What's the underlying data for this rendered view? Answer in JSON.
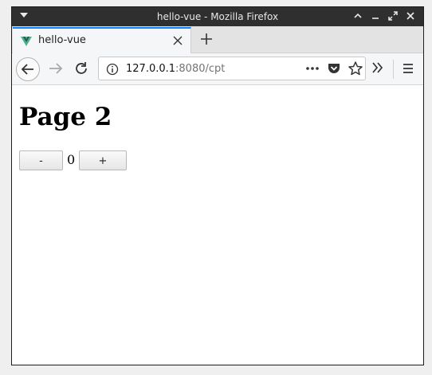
{
  "window": {
    "title": "hello-vue - Mozilla Firefox",
    "controls": [
      "minimize-icon",
      "maximize-icon",
      "restore-icon",
      "close-icon"
    ]
  },
  "tabs": [
    {
      "title": "hello-vue",
      "favicon": "vue-logo-icon",
      "active": true
    }
  ],
  "urlbar": {
    "host": "127.0.0.1",
    "path": ":8080/cpt"
  },
  "page": {
    "heading": "Page 2",
    "decrement_label": "-",
    "increment_label": "+",
    "count": "0"
  },
  "colors": {
    "accent": "#0a84ff",
    "vue_green": "#41b883",
    "vue_dark": "#35495e"
  }
}
